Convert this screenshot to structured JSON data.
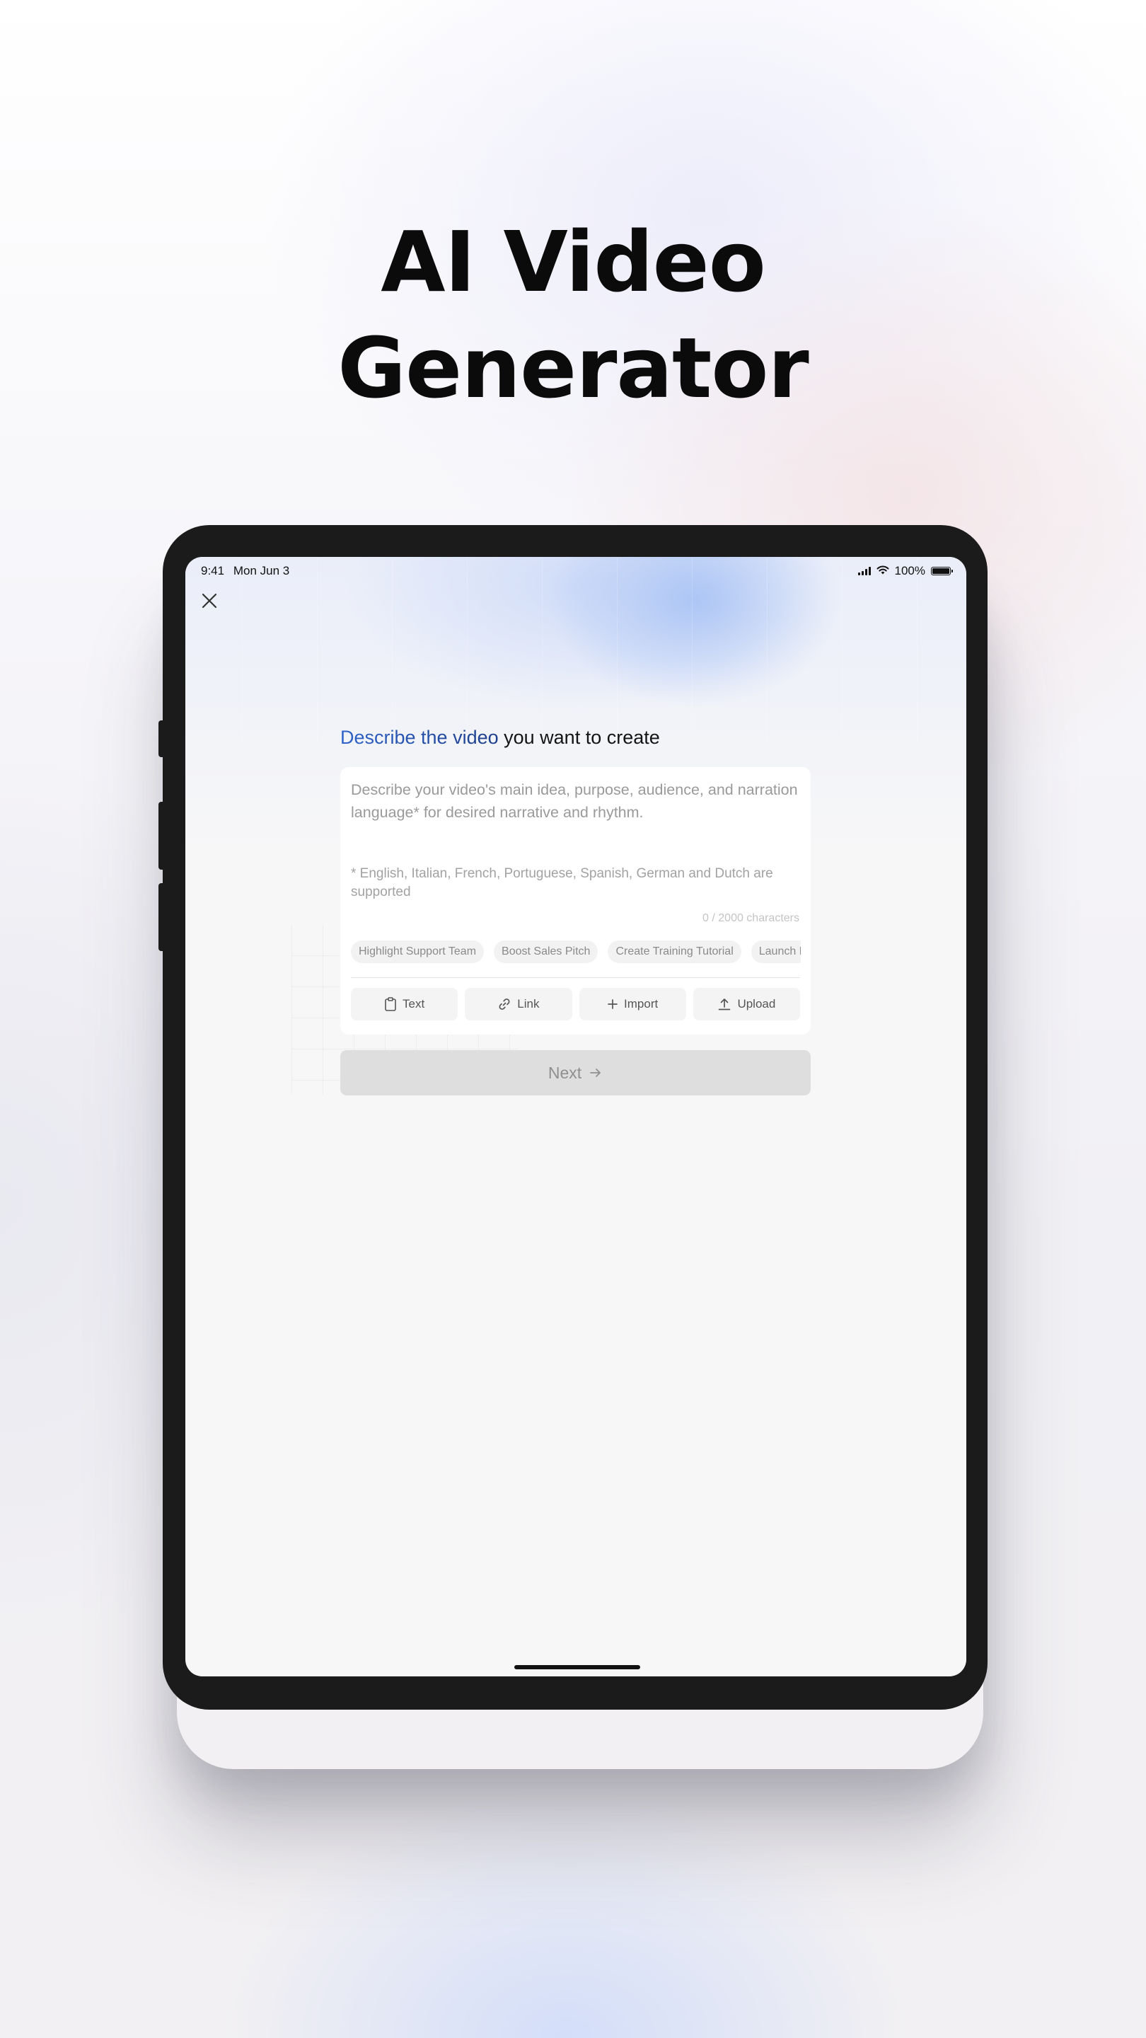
{
  "hero": {
    "title_line1": "AI Video",
    "title_line2": "Generator"
  },
  "status_bar": {
    "time": "9:41",
    "date": "Mon Jun 3",
    "battery": "100%"
  },
  "prompt": {
    "heading_highlight": "Describe the video",
    "heading_rest": " you want to create",
    "placeholder": "Describe your video's main idea, purpose, audience, and narration language* for desired narrative and rhythm.",
    "language_note": "* English, Italian, French, Portuguese, Spanish, German and Dutch are supported",
    "char_count": "0 / 2000 characters",
    "suggestions": [
      "Highlight Support Team",
      "Boost Sales Pitch",
      "Create Training Tutorial",
      "Launch Product Demo"
    ],
    "actions": [
      {
        "label": "Text",
        "icon": "clipboard-icon"
      },
      {
        "label": "Link",
        "icon": "link-icon"
      },
      {
        "label": "Import",
        "icon": "plus-icon"
      },
      {
        "label": "Upload",
        "icon": "upload-icon"
      }
    ]
  },
  "next_button": {
    "label": "Next"
  },
  "colors": {
    "accent_gradient_start": "#2f63c9",
    "accent_gradient_end": "#1c3f8a",
    "disabled_button": "#dedede",
    "device_frame": "#1b1b1b"
  }
}
